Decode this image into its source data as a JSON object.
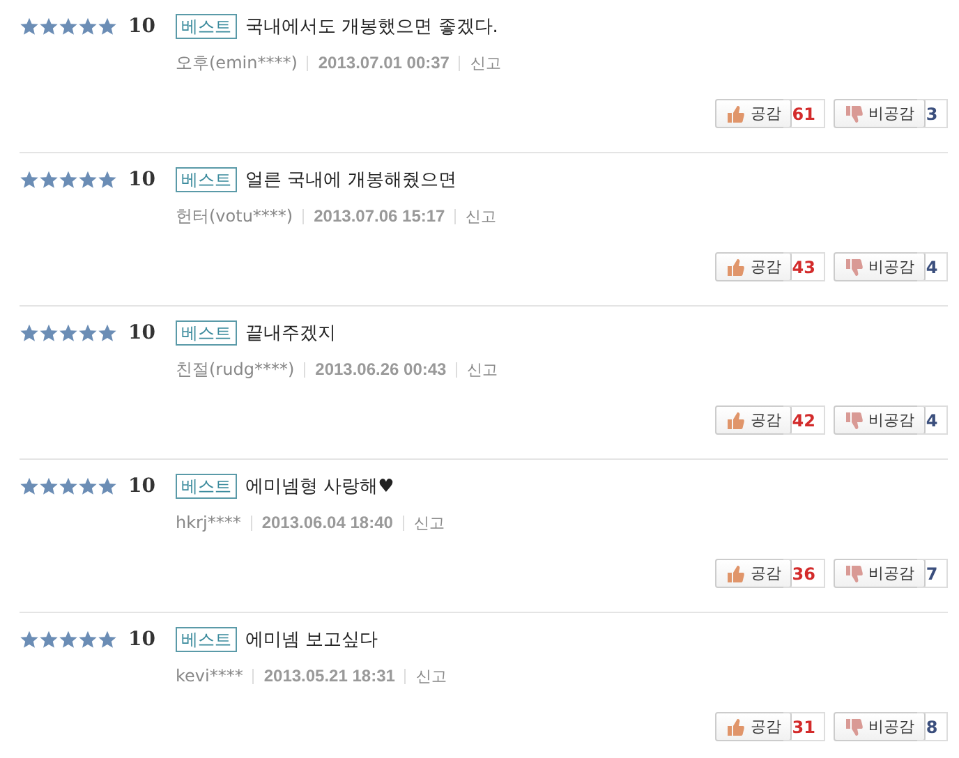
{
  "reviews": [
    {
      "stars": 5,
      "score": "10",
      "badge": "베스트",
      "text": "국내에서도 개봉했으면 좋겠다.",
      "author": "오후(emin****)",
      "date": "2013.07.01 00:37",
      "report": "신고",
      "like_label": "공감",
      "likes": "61",
      "dislike_label": "비공감",
      "dislikes": "3"
    },
    {
      "stars": 5,
      "score": "10",
      "badge": "베스트",
      "text": "얼른 국내에 개봉해줬으면",
      "author": "헌터(votu****)",
      "date": "2013.07.06 15:17",
      "report": "신고",
      "like_label": "공감",
      "likes": "43",
      "dislike_label": "비공감",
      "dislikes": "4"
    },
    {
      "stars": 5,
      "score": "10",
      "badge": "베스트",
      "text": "끝내주겠지",
      "author": "친절(rudg****)",
      "date": "2013.06.26 00:43",
      "report": "신고",
      "like_label": "공감",
      "likes": "42",
      "dislike_label": "비공감",
      "dislikes": "4"
    },
    {
      "stars": 5,
      "score": "10",
      "badge": "베스트",
      "text": "에미넴형 사랑해♥",
      "author": "hkrj****",
      "date": "2013.06.04 18:40",
      "report": "신고",
      "like_label": "공감",
      "likes": "36",
      "dislike_label": "비공감",
      "dislikes": "7"
    },
    {
      "stars": 5,
      "score": "10",
      "badge": "베스트",
      "text": "에미넴 보고싶다",
      "author": "kevi****",
      "date": "2013.05.21 18:31",
      "report": "신고",
      "like_label": "공감",
      "likes": "31",
      "dislike_label": "비공감",
      "dislikes": "8"
    }
  ]
}
